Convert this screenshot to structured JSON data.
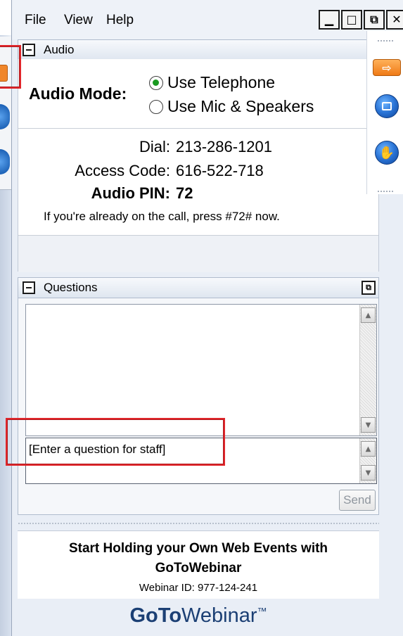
{
  "menu": {
    "file": "File",
    "view": "View",
    "help": "Help"
  },
  "window_buttons": {
    "minimize": "▁",
    "maximize": "□",
    "restore": "⧉",
    "close": "✕"
  },
  "audio": {
    "title": "Audio",
    "mode_label": "Audio Mode:",
    "options": [
      {
        "label": "Use Telephone",
        "checked": true
      },
      {
        "label": "Use Mic & Speakers",
        "checked": false
      }
    ],
    "dial_label": "Dial:",
    "dial_value": "213-286-1201",
    "access_label": "Access Code:",
    "access_value": "616-522-718",
    "pin_label": "Audio PIN:",
    "pin_value": "72",
    "already_text": "If you're already on the call, press #72# now."
  },
  "toolbar": {
    "orange_arrow": "⇨",
    "hand": "✋"
  },
  "questions": {
    "title": "Questions",
    "expand_icon": "⧉",
    "input_value": "[Enter a question for staff]",
    "send_label": "Send"
  },
  "promo": {
    "line1": "Start Holding your Own Web Events with",
    "line2": "GoToWebinar",
    "webinar_id": "Webinar ID: 977-124-241",
    "logo_go": "Go",
    "logo_to": "To",
    "logo_web": "Webinar",
    "logo_tm": "™"
  },
  "colors": {
    "accent_orange": "#ef7a16",
    "logo_blue": "#1b3f74",
    "radio_green": "#1a9a20",
    "highlight_red": "#e0262b"
  }
}
